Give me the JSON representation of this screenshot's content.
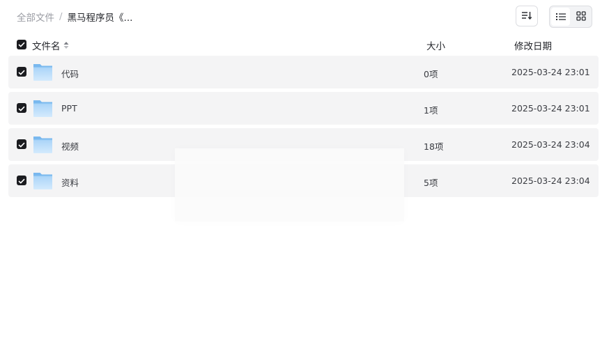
{
  "breadcrumb": {
    "root": "全部文件",
    "separator": "/",
    "current": "黑马程序员《..."
  },
  "toolbar": {
    "sort_icon": "sort-list-icon",
    "list_view_icon": "list-view-icon",
    "grid_view_icon": "grid-view-icon",
    "active_view": "list"
  },
  "header": {
    "name": "文件名",
    "size": "大小",
    "date": "修改日期",
    "select_all_checked": true
  },
  "files": [
    {
      "name": "代码",
      "size": "0项",
      "date": "2025-03-24 23:01",
      "icon": "folder-icon",
      "checked": true
    },
    {
      "name": "PPT",
      "size": "1项",
      "date": "2025-03-24 23:01",
      "icon": "folder-icon",
      "checked": true
    },
    {
      "name": "视频",
      "size": "18项",
      "date": "2025-03-24 23:04",
      "icon": "folder-icon",
      "checked": true
    },
    {
      "name": "资料",
      "size": "5项",
      "date": "2025-03-24 23:04",
      "icon": "folder-icon",
      "checked": true
    }
  ],
  "colors": {
    "checkbox": "#1b1c20",
    "row_background": "#f4f4f5",
    "folder_light": "#bfe0fb",
    "folder_dark": "#79b8ee"
  }
}
